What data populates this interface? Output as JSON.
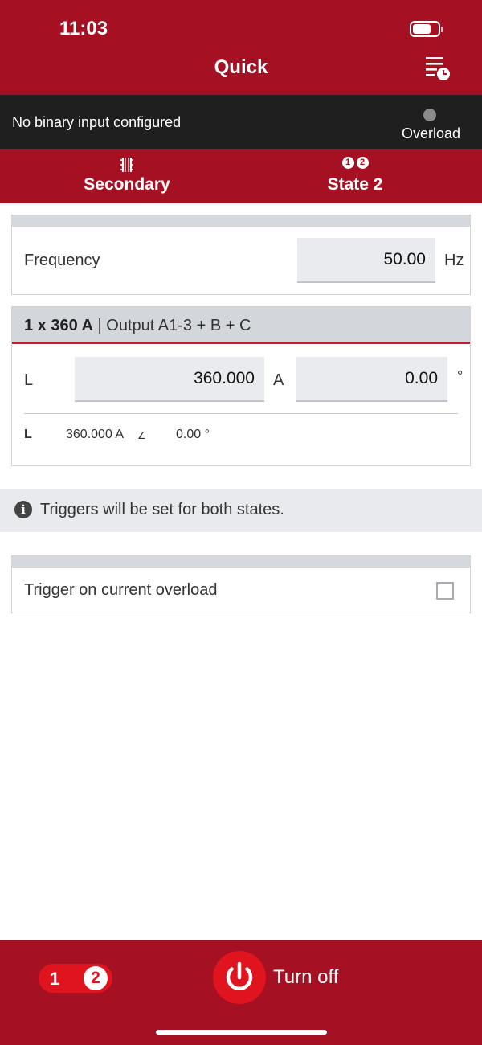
{
  "status_bar": {
    "time": "11:03"
  },
  "header": {
    "title": "Quick",
    "menu_icon": "list-clock-icon"
  },
  "info_bar": {
    "message": "No binary input configured",
    "indicator_label": "Overload",
    "indicator_color": "#8c8c8c"
  },
  "tabs": [
    {
      "label": "Secondary",
      "icon": "transformer-icon"
    },
    {
      "label": "State 2",
      "icon": "state-badges-icon",
      "badges": [
        "1",
        "2"
      ]
    }
  ],
  "frequency": {
    "label": "Frequency",
    "value": "50.00",
    "unit": "Hz"
  },
  "output": {
    "title_bold": "1 x 360 A",
    "title_rest": " | Output A1-3 + B + C",
    "phase": "L",
    "magnitude": "360.000",
    "magnitude_unit": "A",
    "angle": "0.00",
    "angle_unit": "°",
    "summary": {
      "phase": "L",
      "magnitude": "360.000 A",
      "angle_symbol": "∠",
      "angle": "0.00 °"
    }
  },
  "banner": {
    "text": "Triggers will be set for both states."
  },
  "trigger": {
    "label": "Trigger on current overload",
    "checked": false
  },
  "bottom": {
    "state_1": "1",
    "state_2": "2",
    "turn_off_label": "Turn off"
  },
  "colors": {
    "brand": "#a51122",
    "accent": "#e0141f",
    "dark": "#1f1f1f"
  }
}
